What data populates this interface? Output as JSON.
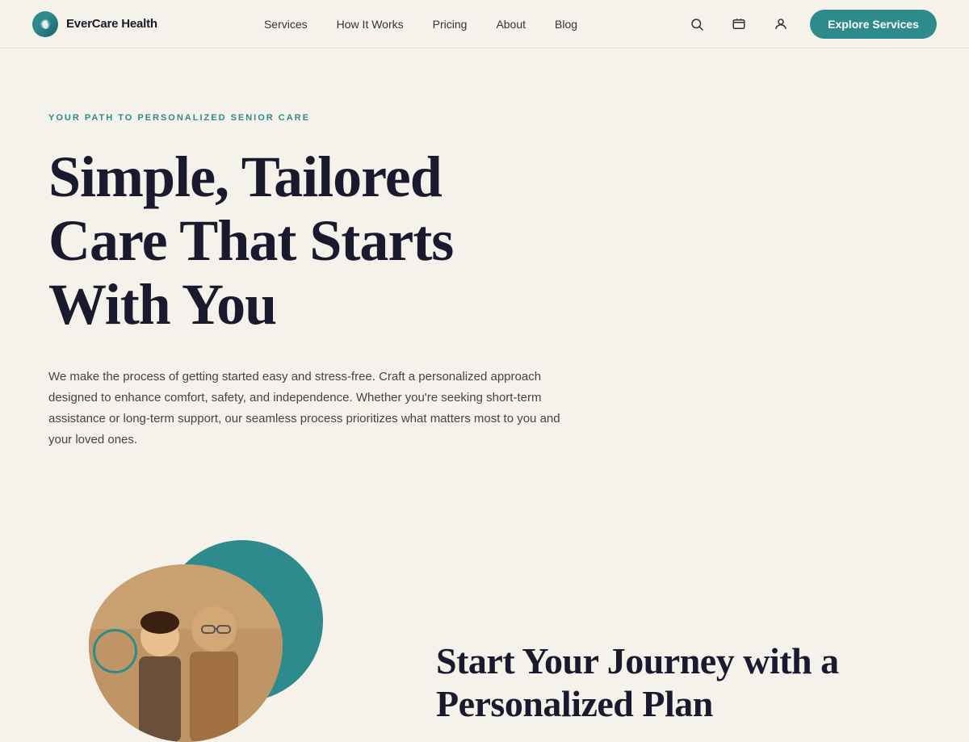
{
  "brand": {
    "name": "EverCare Health",
    "logo_alt": "EverCare Health logo"
  },
  "nav": {
    "links": [
      {
        "label": "Services",
        "href": "#"
      },
      {
        "label": "How It Works",
        "href": "#"
      },
      {
        "label": "Pricing",
        "href": "#"
      },
      {
        "label": "About",
        "href": "#"
      },
      {
        "label": "Blog",
        "href": "#"
      }
    ],
    "explore_button": "Explore Services"
  },
  "hero": {
    "label": "YOUR PATH TO PERSONALIZED SENIOR CARE",
    "title": "Simple, Tailored Care That Starts With You",
    "description": "We make the process of getting started easy and stress-free. Craft a personalized approach designed to enhance comfort, safety, and independence. Whether you're seeking short-term assistance or long-term support, our seamless process prioritizes what matters most to you and your loved ones."
  },
  "lower": {
    "title": "Start Your Journey with a Personalized Plan"
  },
  "colors": {
    "teal": "#2e8b8b",
    "bg": "#f5f2eb",
    "dark": "#1a1a2e"
  }
}
